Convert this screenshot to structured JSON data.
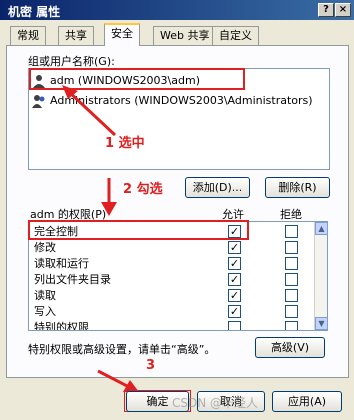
{
  "window": {
    "title": "机密 属性",
    "help_label": "?",
    "close_label": "×"
  },
  "tabs": [
    "常规",
    "共享",
    "安全",
    "Web 共享",
    "自定义"
  ],
  "groups": {
    "label": "组或用户名称(G):",
    "users": [
      {
        "name": "adm (WINDOWS2003\\adm)"
      },
      {
        "name": "Administrators (WINDOWS2003\\Administrators)"
      }
    ],
    "add_label": "添加(D)...",
    "remove_label": "删除(R)"
  },
  "permissions": {
    "title": "adm 的权限(P)",
    "allow_header": "允许",
    "deny_header": "拒绝",
    "rows": [
      {
        "name": "完全控制",
        "allow": "✓",
        "deny": ""
      },
      {
        "name": "修改",
        "allow": "✓",
        "deny": ""
      },
      {
        "name": "读取和运行",
        "allow": "✓",
        "deny": ""
      },
      {
        "name": "列出文件夹目录",
        "allow": "✓",
        "deny": ""
      },
      {
        "name": "读取",
        "allow": "✓",
        "deny": ""
      },
      {
        "name": "写入",
        "allow": "✓",
        "deny": ""
      },
      {
        "name": "特别的权限",
        "allow": "",
        "deny": ""
      }
    ]
  },
  "advanced": {
    "text": "特别权限或高级设置，请单击“高级”。",
    "button_label": "高级(V)"
  },
  "footer": {
    "ok_label": "确定",
    "cancel_label": "取消",
    "apply_label": "应用(A)",
    "watermark": "CSDN @千经人"
  },
  "annotations": {
    "step1": "1   选中",
    "step2": "2 勾选",
    "step3": "3"
  },
  "colors": {
    "titlebar_start": "#0a246a",
    "annotation_red": "#e02020"
  }
}
